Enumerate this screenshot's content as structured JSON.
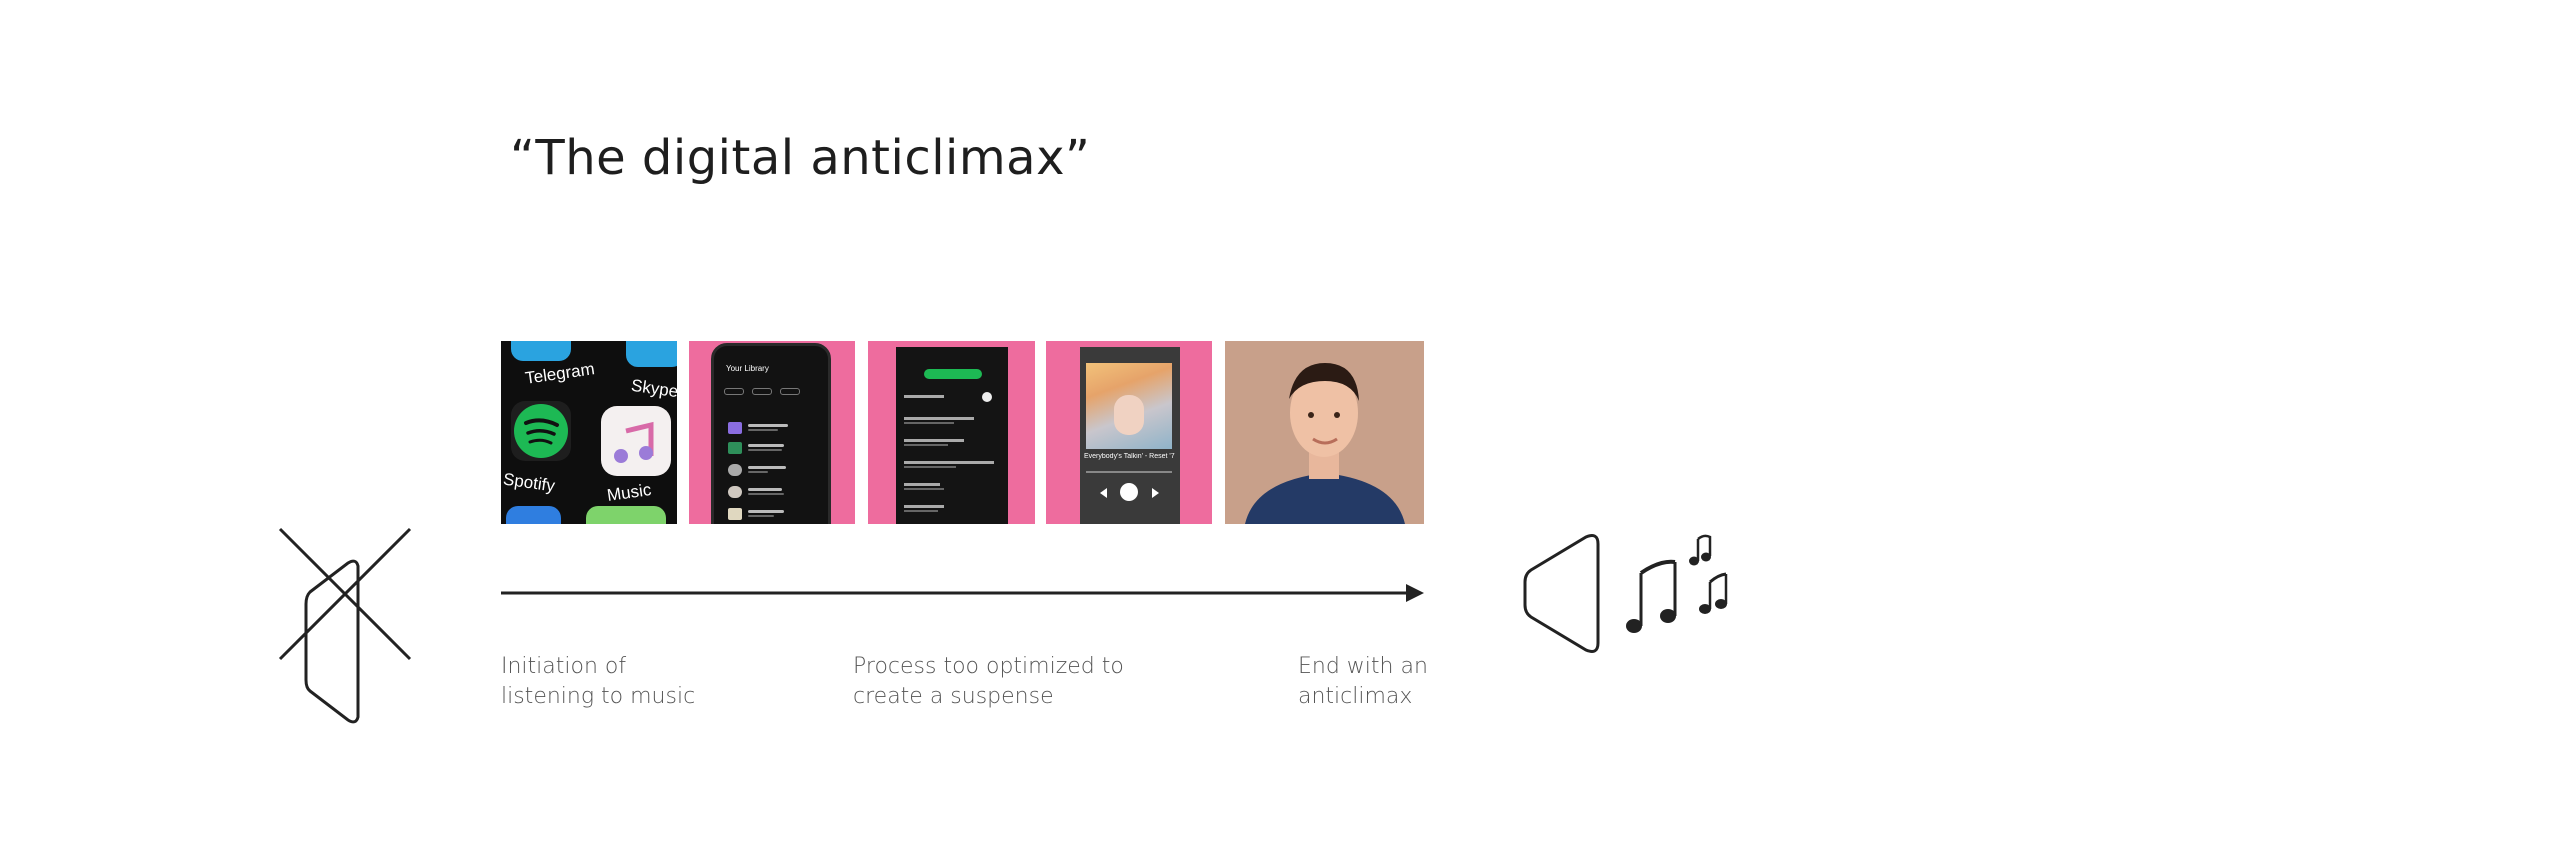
{
  "title": "“The digital anticlimax”",
  "app_icons": [
    "Telegram",
    "Skype",
    "Spotify",
    "Music"
  ],
  "library_screen": {
    "header": "Your Library"
  },
  "player_screen": {
    "song": "Everybody's Talkin' - Reset '7"
  },
  "steps": [
    {
      "label": "Initiation of\nlistening to music"
    },
    {
      "label": "Process too optimized to\ncreate a suspense"
    },
    {
      "label": "End with an\nanticlimax"
    }
  ],
  "icons": [
    "mute-speaker-icon",
    "speaker-icon",
    "music-notes-icon"
  ],
  "colors": {
    "accent_pink": "#ee6c9e",
    "spotify_green": "#1db954",
    "line": "#222222"
  }
}
